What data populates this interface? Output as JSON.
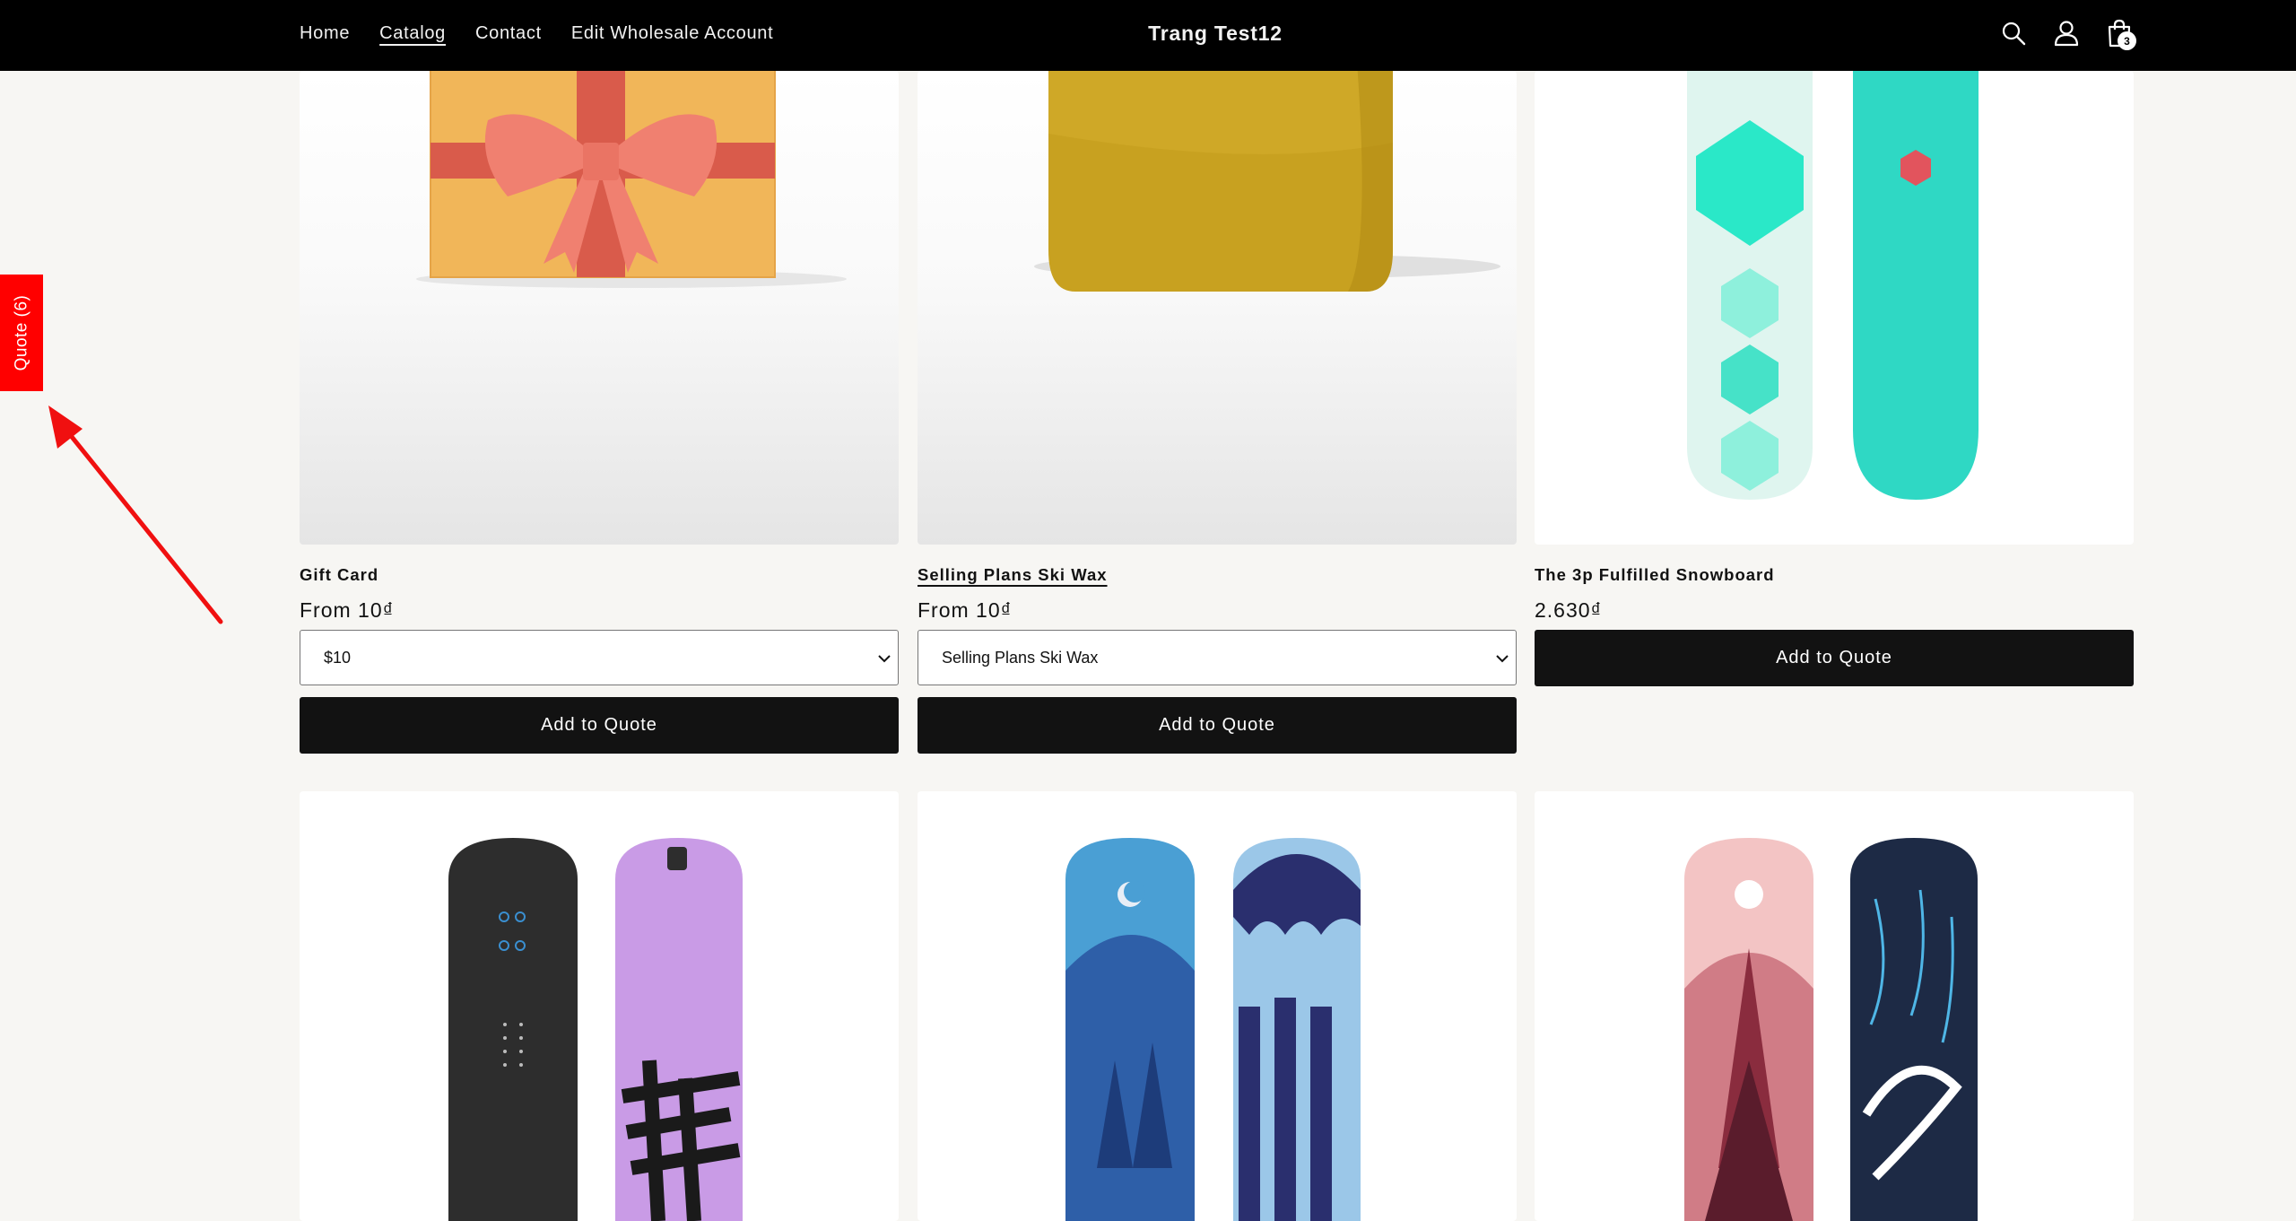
{
  "header": {
    "nav": [
      "Home",
      "Catalog",
      "Contact",
      "Edit Wholesale Account"
    ],
    "active_nav": "Catalog",
    "brand": "Trang Test12",
    "icons": [
      "search-icon",
      "account-icon",
      "cart-icon"
    ],
    "cart_count": "3"
  },
  "quote_tab": {
    "label": "Quote (6)"
  },
  "colors": {
    "header_bg": "#000000",
    "quote_tab": "#ff0000",
    "button_bg": "#121212",
    "page_bg": "#f7f6f3"
  },
  "products": [
    {
      "title": "Gift Card",
      "price": "From 10₫",
      "variant": "$10",
      "button": "Add to Quote"
    },
    {
      "title": "Selling Plans Ski Wax",
      "price": "From 10₫",
      "variant": "Selling Plans Ski Wax",
      "button": "Add to Quote"
    },
    {
      "title": "The 3p Fulfilled Snowboard",
      "price": "2.630₫",
      "button": "Add to Quote"
    }
  ]
}
